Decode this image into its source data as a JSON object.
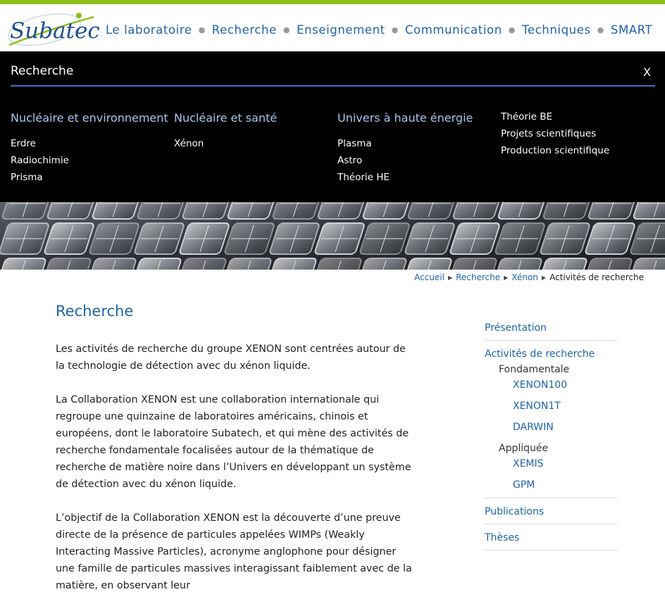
{
  "header": {
    "logo_text": "Subatech",
    "nav": [
      "Le laboratoire",
      "Recherche",
      "Enseignement",
      "Communication",
      "Techniques",
      "SMART"
    ]
  },
  "megamenu": {
    "title": "Recherche",
    "close_label": "X",
    "columns": [
      {
        "heading": "Nucléaire et environnement",
        "links": [
          "Erdre",
          "Radiochimie",
          "Prisma"
        ]
      },
      {
        "heading": "Nucléaire et santé",
        "links": [
          "Xénon"
        ]
      },
      {
        "heading": "Univers à haute énergie",
        "links": [
          "Plasma",
          "Astro",
          "Théorie HE"
        ]
      },
      {
        "heading": "",
        "links": [
          "Théorie BE",
          "Projets scientifiques",
          "Production scientifique"
        ]
      }
    ]
  },
  "breadcrumb": {
    "items": [
      "Accueil",
      "Recherche",
      "Xénon"
    ],
    "current": "Activités de recherche"
  },
  "main": {
    "title": "Recherche",
    "paragraphs": [
      "Les activités de recherche du groupe XENON sont centrées autour de la technologie de détection avec du xénon liquide.",
      "La Collaboration XENON est une collaboration internationale qui regroupe une quinzaine de laboratoires américains, chinois et européens, dont le laboratoire Subatech, et qui mène des activités de recherche fondamentale focalisées autour de la thématique de recherche de matière noire dans l’Univers en développant un système de détection avec du xénon liquide.",
      "L’objectif de la Collaboration XENON est la découverte d’une preuve directe de la présence de particules appelées WIMPs (Weakly Interacting Massive Particles), acronyme anglophone pour désigner une famille de particules massives interagissant faiblement avec de la matière, en observant leur"
    ]
  },
  "sidebar": {
    "presentation": "Présentation",
    "activites": "Activités de recherche",
    "fondamentale": "Fondamentale",
    "fond_items": [
      "XENON100",
      "XENON1T",
      "DARWIN"
    ],
    "appliquee": "Appliquée",
    "appl_items": [
      "XEMIS",
      "GPM"
    ],
    "publications": "Publications",
    "theses": "Thèses"
  },
  "colors": {
    "accent": "#1f63a7",
    "topbar": "#8fbf1c",
    "menu_bg": "#000000",
    "menu_heading": "#a9c6ee",
    "menu_line": "#3b6fc4"
  }
}
